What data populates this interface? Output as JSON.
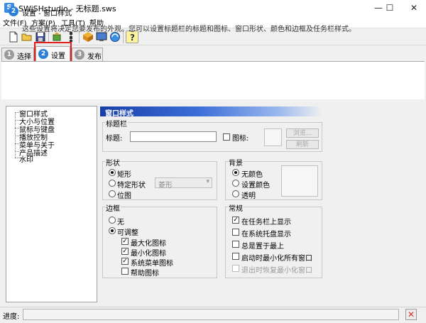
{
  "window": {
    "title": "SWiSHstudio - 无标题.sws",
    "app_icon_letter": "S",
    "minimize": "—",
    "maximize": "☐",
    "close": "✕"
  },
  "menu": [
    "文件(F)",
    "方案(P)",
    "工具(T)",
    "帮助"
  ],
  "toolbar": [
    "new-file",
    "open-folder",
    "save",
    "import",
    "properties",
    "package",
    "preview",
    "publish",
    "help"
  ],
  "tabs": [
    {
      "num": "1",
      "label": "选择"
    },
    {
      "num": "2",
      "label": "设置"
    },
    {
      "num": "3",
      "label": "发布"
    }
  ],
  "header": {
    "num": "2",
    "title": "设置 - 窗口样式",
    "desc": "这些设置将决定您要发布的外观。您可以设置标题栏的标题和图标、窗口形状、颜色和边框及任务栏样式。"
  },
  "tree": [
    "窗口样式",
    "大小与位置",
    "鼠标与键盘",
    "播放控制",
    "菜单与关于",
    "产品描述",
    "水印"
  ],
  "section_title": "窗口样式",
  "titlebar_group": {
    "label": "标题栏",
    "title_label": "标题:",
    "title_value": "",
    "icon_label": "图标:",
    "browse": "浏览...",
    "refresh": "刷新"
  },
  "shape_group": {
    "label": "形状",
    "options": [
      "矩形",
      "特定形状",
      "位图"
    ],
    "selected": 0,
    "shape_combo": "菱形"
  },
  "background_group": {
    "label": "背景",
    "options": [
      "无颜色",
      "设置颜色",
      "透明"
    ],
    "selected": 0
  },
  "border_group": {
    "label": "边框",
    "options": [
      "无",
      "可调整"
    ],
    "selected": 1,
    "checks": [
      {
        "label": "最大化图标",
        "checked": true
      },
      {
        "label": "最小化图标",
        "checked": true
      },
      {
        "label": "系统菜单图标",
        "checked": true
      },
      {
        "label": "帮助图标",
        "checked": false
      }
    ]
  },
  "general_group": {
    "label": "常规",
    "checks": [
      {
        "label": "在任务栏上显示",
        "checked": true
      },
      {
        "label": "在系统托盘显示",
        "checked": false
      },
      {
        "label": "总是置于最上",
        "checked": false
      },
      {
        "label": "启动时最小化所有窗口",
        "checked": false
      },
      {
        "label": "退出时恢复最小化窗口",
        "checked": false,
        "disabled": true
      }
    ]
  },
  "status": {
    "label": "进度:",
    "stop_icon": "✕"
  },
  "colors": {
    "accent": "#2b7fd9",
    "highlight": "#e21b1b",
    "banner": "#1a3ea8"
  }
}
